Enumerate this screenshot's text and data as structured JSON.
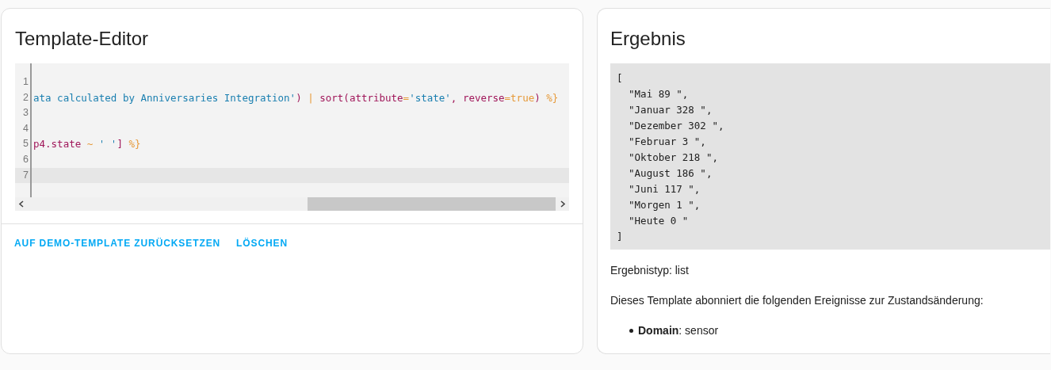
{
  "editor": {
    "title": "Template-Editor",
    "lines": [
      {
        "number": "1",
        "active": false
      },
      {
        "number": "2",
        "active": false,
        "tokens": [
          {
            "kind": "string",
            "text": "ata calculated by Anniversaries Integration'"
          },
          {
            "kind": "name",
            "text": ")"
          },
          {
            "kind": "operator",
            "text": " | "
          },
          {
            "kind": "name",
            "text": "sort(attribute"
          },
          {
            "kind": "operator",
            "text": "="
          },
          {
            "kind": "string",
            "text": "'state'"
          },
          {
            "kind": "name",
            "text": ", reverse"
          },
          {
            "kind": "operator",
            "text": "=true"
          },
          {
            "kind": "name",
            "text": ")"
          },
          {
            "kind": "operator",
            "text": " %}"
          }
        ]
      },
      {
        "number": "3",
        "active": false
      },
      {
        "number": "4",
        "active": false
      },
      {
        "number": "5",
        "active": false,
        "tokens": [
          {
            "kind": "name",
            "text": "p4.state"
          },
          {
            "kind": "operator",
            "text": " ~ "
          },
          {
            "kind": "string",
            "text": "' '"
          },
          {
            "kind": "name",
            "text": "]"
          },
          {
            "kind": "operator",
            "text": " %}"
          }
        ]
      },
      {
        "number": "6",
        "active": false
      },
      {
        "number": "7",
        "active": true
      }
    ],
    "actions": [
      "AUF DEMO-TEMPLATE ZURÜCKSETZEN",
      "LÖSCHEN"
    ]
  },
  "result": {
    "title": "Ergebnis",
    "output": [
      "[",
      "  \"Mai 89 \",",
      "  \"Januar 328 \",",
      "  \"Dezember 302 \",",
      "  \"Februar 3 \",",
      "  \"Oktober 218 \",",
      "  \"August 186 \",",
      "  \"Juni 117 \",",
      "  \"Morgen 1 \",",
      "  \"Heute 0 \"",
      "]"
    ],
    "type_text": "Ergebnistyp: list",
    "listeners_text": "Dieses Template abonniert die folgenden Ereignisse zur Zustandsänderung:",
    "listeners": [
      "**Domain**: sensor"
    ]
  }
}
